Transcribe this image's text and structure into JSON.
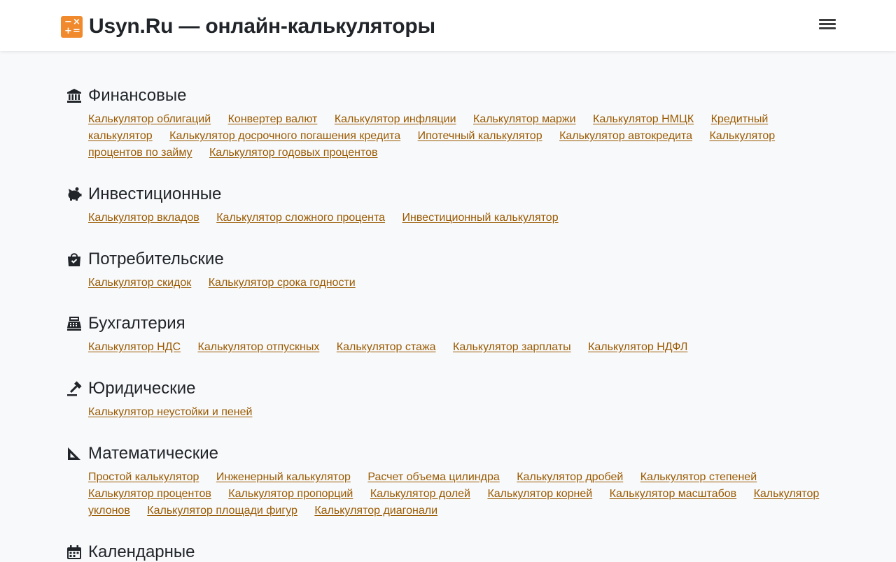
{
  "header": {
    "title": "Usyn.Ru — онлайн-калькуляторы",
    "logo_icon": "calculator-icon",
    "menu_icon": "hamburger-menu-icon"
  },
  "colors": {
    "accent": "#f08a2c",
    "link": "#9a5a00",
    "background": "#f8f9fb",
    "header_bg": "#ffffff"
  },
  "categories": [
    {
      "title": "Финансовые",
      "icon": "bank-icon",
      "links": [
        "Калькулятор облигаций",
        "Конвертер валют",
        "Калькулятор инфляции",
        "Калькулятор маржи",
        "Калькулятор НМЦК",
        "Кредитный калькулятор",
        "Калькулятор досрочного погашения кредита",
        "Ипотечный калькулятор",
        "Калькулятор автокредита",
        "Калькулятор процентов по займу",
        "Калькулятор годовых процентов"
      ]
    },
    {
      "title": "Инвестиционные",
      "icon": "piggy-bank-icon",
      "links": [
        "Калькулятор вкладов",
        "Калькулятор сложного процента",
        "Инвестиционный калькулятор"
      ]
    },
    {
      "title": "Потребительские",
      "icon": "shopping-bag-icon",
      "links": [
        "Калькулятор скидок",
        "Калькулятор срока годности"
      ]
    },
    {
      "title": "Бухгалтерия",
      "icon": "cash-register-icon",
      "links": [
        "Калькулятор НДС",
        "Калькулятор отпускных",
        "Калькулятор стажа",
        "Калькулятор зарплаты",
        "Калькулятор НДФЛ"
      ]
    },
    {
      "title": "Юридические",
      "icon": "gavel-icon",
      "links": [
        "Калькулятор неустойки и пеней"
      ]
    },
    {
      "title": "Математические",
      "icon": "ruler-triangle-icon",
      "links": [
        "Простой калькулятор",
        "Инженерный калькулятор",
        "Расчет объема цилиндра",
        "Калькулятор дробей",
        "Калькулятор степеней",
        "Калькулятор процентов",
        "Калькулятор пропорций",
        "Калькулятор долей",
        "Калькулятор корней",
        "Калькулятор масштабов",
        "Калькулятор уклонов",
        "Калькулятор площади фигур",
        "Калькулятор диагонали"
      ]
    },
    {
      "title": "Календарные",
      "icon": "calendar-icon",
      "links": []
    }
  ]
}
